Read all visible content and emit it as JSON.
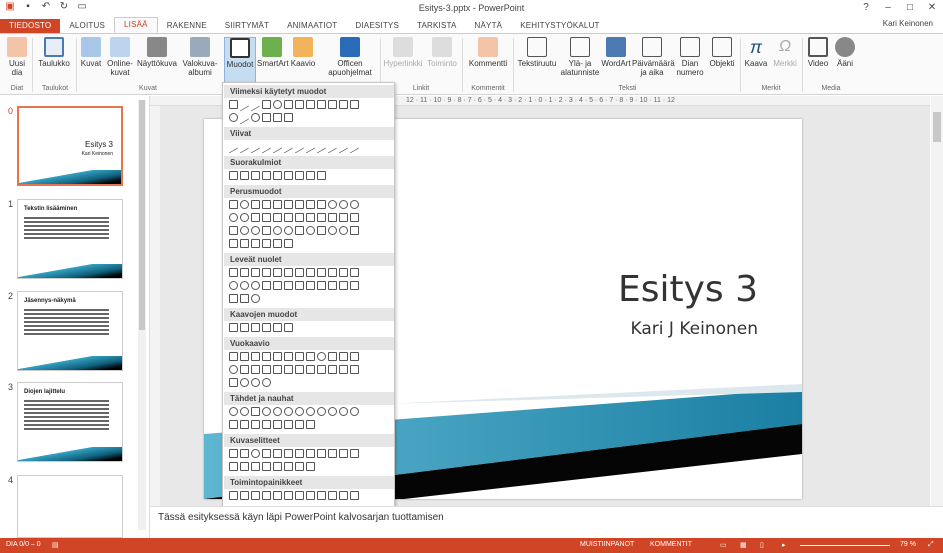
{
  "window": {
    "title": "Esitys-3.pptx - PowerPoint",
    "user": "Kari Keinonen",
    "help": "?",
    "minimize": "–",
    "restore": "□",
    "close": "✕"
  },
  "tabs": [
    "TIEDOSTO",
    "ALOITUS",
    "LISÄÄ",
    "RAKENNE",
    "SIIRTYMÄT",
    "ANIMAATIOT",
    "DIAESITYS",
    "TARKISTA",
    "NÄYTÄ",
    "KEHITYSTYÖKALUT"
  ],
  "ribbon": {
    "buttons": [
      "Uusi dia",
      "Taulukko",
      "Kuvat",
      "Online-kuvat",
      "Näyttökuva",
      "Valokuva-albumi",
      "Muodot",
      "SmartArt",
      "Kaavio",
      "Officen apuohjelmat",
      "Hyperlinkki",
      "Toiminto",
      "Kommentti",
      "Tekstiruutu",
      "Ylä- ja alatunniste",
      "WordArt",
      "Päivämäärä ja aika",
      "Dian numero",
      "Objekti",
      "Kaava",
      "Merkki",
      "Video",
      "Ääni"
    ],
    "groups": [
      "Diat",
      "Taulukot",
      "Kuvat",
      "Linkit",
      "Kommentit",
      "Teksti",
      "Merkit",
      "Media"
    ]
  },
  "shapes_menu": {
    "sections": [
      "Viimeksi käytetyt muodot",
      "Viivat",
      "Suorakulmiot",
      "Perusmuodot",
      "Leveät nuolet",
      "Kaavojen muodot",
      "Vuokaavio",
      "Tähdet ja nauhat",
      "Kuvaselitteet",
      "Toimintopainikkeet"
    ]
  },
  "thumbnails": [
    {
      "num": "0",
      "title": "Esitys 3",
      "subtitle": "Kari Keinonen"
    },
    {
      "num": "1",
      "title": "Tekstin lisääminen"
    },
    {
      "num": "2",
      "title": "Jäsennys-näkymä"
    },
    {
      "num": "3",
      "title": "Diojen lajittelu"
    },
    {
      "num": "4",
      "title": ""
    }
  ],
  "ruler": {
    "h": "12 · 11 · 10 · 9 · 8 · 7 · 6 · 5 · 4 · 3 · 2 · 1 · 0 · 1 · 2 · 3 · 4 · 5 · 6 · 7 · 8 · 9 · 10 · 11 · 12"
  },
  "slide": {
    "title": "Esitys 3",
    "subtitle": "Kari J Keinonen"
  },
  "notes": "Tässä esityksessä käyn läpi PowerPoint kalvosarjan tuottamisen",
  "status": {
    "slide": "DIA 0/0 – 0",
    "notes": "MUISTIINPANOT",
    "comments": "KOMMENTIT",
    "zoom": "79 %"
  },
  "colors": {
    "accent": "#d04525",
    "teal": "#35a2c2"
  }
}
